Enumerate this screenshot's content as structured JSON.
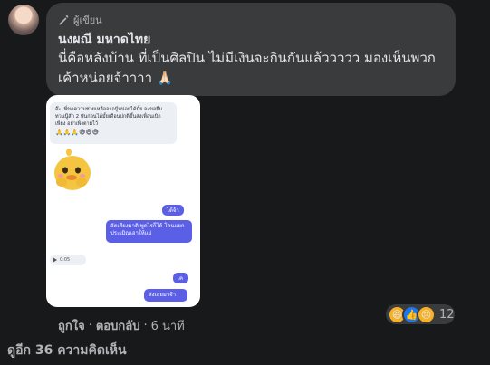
{
  "comment": {
    "author_badge": "ผู้เขียน",
    "author_name": "นงผณี มหาดไทย",
    "text": "นี่คือหลังบ้าน ที่เป็นศิลปิน ไม่มีเงินจะกินกันแล้ววววว มองเห็นพวกเค้าหน่อยจ้าาาา 🙏🏻",
    "screenshot": {
      "received_text": "จ๊ะ..พี่ขอความช่วยเหลือจากปู้หน่อยได้มั้ย จะขอยืมทวนนู๊สัก 2 พันก่อนได้มั้ยเดือนปกติขึ้นส่งเพื่อนเบิกเพียง อย่าเพิ่งตามไว้",
      "received_emojis": "🙏🙏🙏😅😅😅",
      "sent_1": "ได้จ้า",
      "sent_2": "อัตเสียงมาดิ พูดไรก็ได้ โดนแยกประเมิณเอาให้แม่",
      "audio_time": "0:05",
      "sent_3": "เค",
      "sent_4": "ส่งเลยมาจ้า"
    }
  },
  "actions": {
    "like": "ถูกใจ",
    "separator": "·",
    "reply": "ตอบกลับ",
    "time": "6 นาที"
  },
  "reactions": {
    "count": "12",
    "icons": [
      "haha-icon",
      "like-icon",
      "sad-icon"
    ],
    "colors": {
      "haha": "#f7b125",
      "like": "#1877f2"
    }
  },
  "more_comments": "ดูอีก 36 ความคิดเห็น",
  "colors": {
    "background": "#18191a",
    "bubble": "#3a3b3c",
    "primary_text": "#e4e6eb",
    "secondary_text": "#b0b3b8",
    "sent_bubble": "#5b5fe6"
  }
}
